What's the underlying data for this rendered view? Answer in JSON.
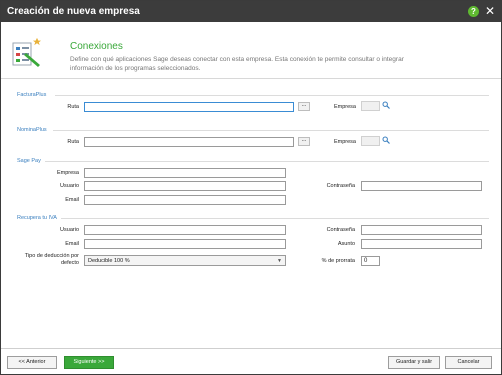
{
  "window": {
    "title": "Creación de nueva empresa",
    "help_icon": "question-icon",
    "close_icon": "close-icon"
  },
  "header": {
    "title": "Conexiones",
    "description": "Define con qué aplicaciones Sage deseas conectar con esta empresa. Esta conexión te permite consultar o integrar información de los programas seleccionados."
  },
  "sections": {
    "facturaplus": {
      "title": "FacturaPlus",
      "ruta_label": "Ruta",
      "ruta_value": "",
      "browse": "...",
      "empresa_label": "Empresa",
      "empresa_value": ""
    },
    "nominaplus": {
      "title": "NominaPlus",
      "ruta_label": "Ruta",
      "ruta_value": "",
      "browse": "...",
      "empresa_label": "Empresa",
      "empresa_value": ""
    },
    "sagepay": {
      "title": "Sage Pay",
      "empresa_label": "Empresa",
      "empresa_value": "",
      "usuario_label": "Usuario",
      "usuario_value": "",
      "contrasena_label": "Contraseña",
      "contrasena_value": "",
      "email_label": "Email",
      "email_value": ""
    },
    "recupera": {
      "title": "Recupera tu IVA",
      "usuario_label": "Usuario",
      "usuario_value": "",
      "contrasena_label": "Contraseña",
      "contrasena_value": "",
      "email_label": "Email",
      "email_value": "",
      "asunto_label": "Asunto",
      "asunto_value": "",
      "deduccion_label_1": "Tipo de deducción por",
      "deduccion_label_2": "defecto",
      "deduccion_value": "Deducible 100 %",
      "prorrata_label": "% de prorrata",
      "prorrata_value": "0"
    }
  },
  "footer": {
    "back": "<< Anterior",
    "next": "Siguiente >>",
    "save": "Guardar y salir",
    "cancel": "Cancelar"
  },
  "colors": {
    "titlebar": "#3c3c3c",
    "accent_green": "#3aa83a",
    "section_blue": "#3a7fbf"
  }
}
